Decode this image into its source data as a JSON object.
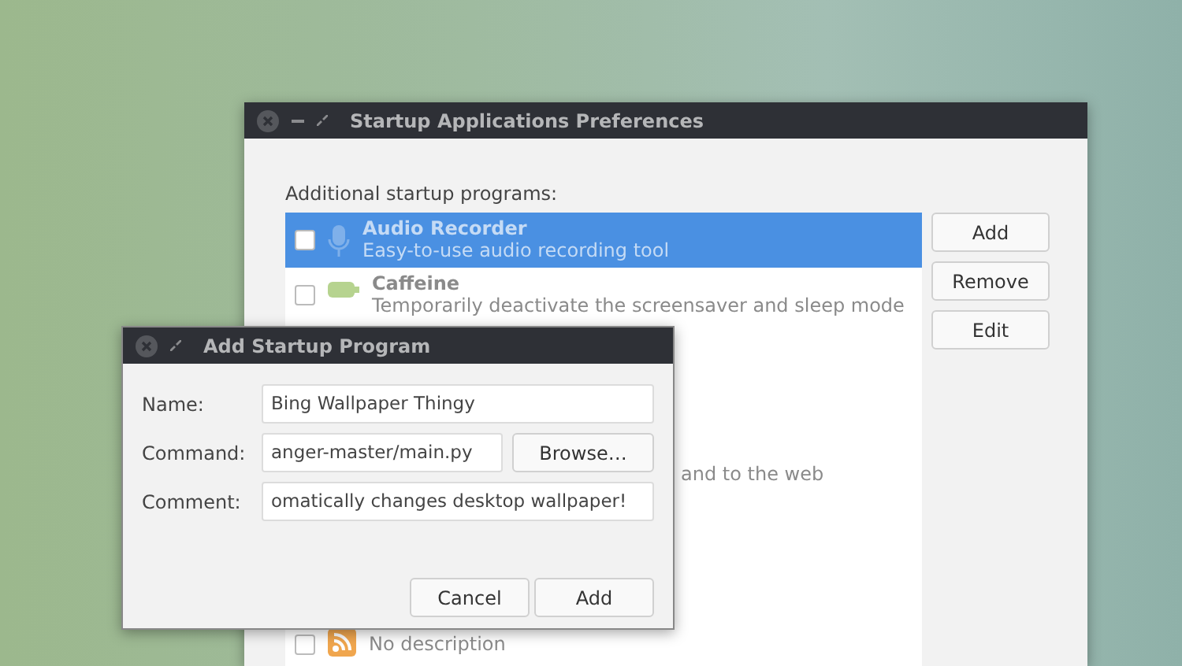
{
  "main_window": {
    "title": "Startup Applications Preferences",
    "list_label": "Additional startup programs:",
    "programs": [
      {
        "kind": "full",
        "name": "Audio Recorder",
        "description": "Easy-to-use audio recording tool",
        "checked": false,
        "selected": true
      },
      {
        "kind": "full",
        "name": "Caffeine",
        "description": "Temporarily deactivate the screensaver and sleep mode",
        "checked": false,
        "selected": false
      },
      {
        "kind": "covered",
        "description": "and to the web",
        "selected": false
      },
      {
        "kind": "covered",
        "description": "No description",
        "checked": false,
        "selected": false
      }
    ],
    "buttons": [
      "Add",
      "Remove",
      "Edit"
    ]
  },
  "dialog": {
    "title": "Add Startup Program",
    "fields": [
      {
        "label": "Name:",
        "value": "Bing Wallpaper Thingy"
      },
      {
        "label": "Command:",
        "value": "anger-master/main.py",
        "button": "Browse…"
      },
      {
        "label": "Comment:",
        "value": "omatically changes desktop wallpaper!"
      }
    ],
    "buttons": [
      "Cancel",
      "Add"
    ]
  }
}
